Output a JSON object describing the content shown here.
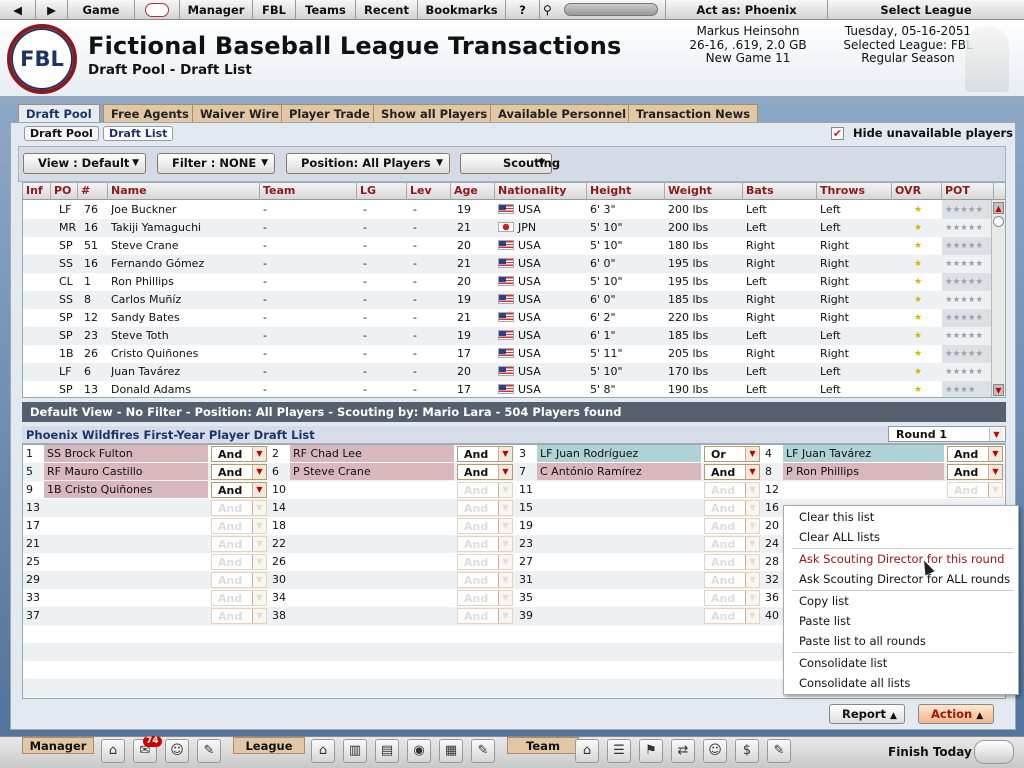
{
  "topbar": {
    "back": "◀",
    "fwd": "▶",
    "game": "Game",
    "manager": "Manager",
    "fbl": "FBL",
    "teams": "Teams",
    "recent": "Recent",
    "bookmarks": "Bookmarks",
    "help": "?",
    "act_as": "Act as: Phoenix",
    "select_league": "Select League"
  },
  "header": {
    "logo": "FBL",
    "title": "Fictional Baseball League Transactions",
    "subtitle": "Draft Pool - Draft List",
    "user_name": "Markus Heinsohn",
    "user_record": "26-16, .619, 2.0 GB",
    "user_game": "New Game 11",
    "date": "Tuesday, 05-16-2051",
    "selected_league": "Selected League: FBL",
    "season": "Regular Season"
  },
  "tabs": [
    "Draft Pool",
    "Free Agents",
    "Waiver Wire",
    "Player Trade",
    "Show all Players",
    "Available Personnel",
    "Transaction News"
  ],
  "subtabs": [
    "Draft Pool",
    "Draft List"
  ],
  "hide_unavailable": {
    "label": "Hide unavailable players",
    "checked": "✔"
  },
  "filters": {
    "view": "View : Default",
    "filter": "Filter : NONE",
    "position": "Position: All Players",
    "scouting": "Scouting"
  },
  "columns": [
    "Inf",
    "PO",
    "#",
    "Name",
    "Team",
    "LG",
    "Lev",
    "Age",
    "Nationality",
    "Height",
    "Weight",
    "Bats",
    "Throws",
    "OVR",
    "POT"
  ],
  "players": [
    {
      "pos": "LF",
      "num": "76",
      "name": "Joe Buckner",
      "team": "-",
      "lg": "-",
      "lev": "-",
      "age": "19",
      "nat": "USA",
      "flag": "usa",
      "height": "6' 3\"",
      "weight": "200 lbs",
      "bats": "Left",
      "throws": "Left",
      "ovr": "★",
      "pot": "★★★★★"
    },
    {
      "pos": "MR",
      "num": "16",
      "name": "Takiji Yamaguchi",
      "team": "-",
      "lg": "-",
      "lev": "-",
      "age": "21",
      "nat": "JPN",
      "flag": "jpn",
      "height": "5' 10\"",
      "weight": "200 lbs",
      "bats": "Left",
      "throws": "Left",
      "ovr": "★",
      "pot": "★★★★★"
    },
    {
      "pos": "SP",
      "num": "51",
      "name": "Steve Crane",
      "team": "-",
      "lg": "-",
      "lev": "-",
      "age": "20",
      "nat": "USA",
      "flag": "usa",
      "height": "5' 10\"",
      "weight": "180 lbs",
      "bats": "Right",
      "throws": "Right",
      "ovr": "★",
      "pot": "★★★★★"
    },
    {
      "pos": "SS",
      "num": "16",
      "name": "Fernando Gómez",
      "team": "-",
      "lg": "-",
      "lev": "-",
      "age": "21",
      "nat": "USA",
      "flag": "usa",
      "height": "6' 0\"",
      "weight": "195 lbs",
      "bats": "Right",
      "throws": "Right",
      "ovr": "★",
      "pot": "★★★★★"
    },
    {
      "pos": "CL",
      "num": "1",
      "name": "Ron Phillips",
      "team": "-",
      "lg": "-",
      "lev": "-",
      "age": "20",
      "nat": "USA",
      "flag": "usa",
      "height": "5' 10\"",
      "weight": "195 lbs",
      "bats": "Left",
      "throws": "Right",
      "ovr": "★",
      "pot": "★★★★★"
    },
    {
      "pos": "SS",
      "num": "8",
      "name": "Carlos Muñíz",
      "team": "-",
      "lg": "-",
      "lev": "-",
      "age": "19",
      "nat": "USA",
      "flag": "usa",
      "height": "6' 0\"",
      "weight": "185 lbs",
      "bats": "Right",
      "throws": "Right",
      "ovr": "★",
      "pot": "★★★★★"
    },
    {
      "pos": "SP",
      "num": "12",
      "name": "Sandy Bates",
      "team": "-",
      "lg": "-",
      "lev": "-",
      "age": "21",
      "nat": "USA",
      "flag": "usa",
      "height": "6' 2\"",
      "weight": "220 lbs",
      "bats": "Right",
      "throws": "Right",
      "ovr": "★",
      "pot": "★★★★★"
    },
    {
      "pos": "SP",
      "num": "23",
      "name": "Steve Toth",
      "team": "-",
      "lg": "-",
      "lev": "-",
      "age": "19",
      "nat": "USA",
      "flag": "usa",
      "height": "6' 1\"",
      "weight": "185 lbs",
      "bats": "Left",
      "throws": "Left",
      "ovr": "★",
      "pot": "★★★★★"
    },
    {
      "pos": "1B",
      "num": "26",
      "name": "Cristo Quiñones",
      "team": "-",
      "lg": "-",
      "lev": "-",
      "age": "17",
      "nat": "USA",
      "flag": "usa",
      "height": "5' 11\"",
      "weight": "205 lbs",
      "bats": "Right",
      "throws": "Right",
      "ovr": "★",
      "pot": "★★★★★"
    },
    {
      "pos": "LF",
      "num": "6",
      "name": "Juan Tavárez",
      "team": "-",
      "lg": "-",
      "lev": "-",
      "age": "20",
      "nat": "USA",
      "flag": "usa",
      "height": "5' 10\"",
      "weight": "170 lbs",
      "bats": "Left",
      "throws": "Left",
      "ovr": "★",
      "pot": "★★★★★"
    },
    {
      "pos": "SP",
      "num": "13",
      "name": "Donald Adams",
      "team": "-",
      "lg": "-",
      "lev": "-",
      "age": "17",
      "nat": "USA",
      "flag": "usa",
      "height": "5' 8\"",
      "weight": "190 lbs",
      "bats": "Left",
      "throws": "Left",
      "ovr": "★",
      "pot": "★★★★"
    }
  ],
  "status_line": "Default View - No Filter - Position: All Players - Scouting by: Mario Lara - 504 Players found",
  "draft_list": {
    "title": "Phoenix Wildfires First-Year Player Draft List",
    "round": "Round 1",
    "slots": [
      {
        "n": "1",
        "name": "SS Brock Fulton",
        "op": "And",
        "style": "p"
      },
      {
        "n": "2",
        "name": "RF Chad Lee",
        "op": "And",
        "style": "p"
      },
      {
        "n": "3",
        "name": "LF Juan Rodríguez",
        "op": "Or",
        "style": "t"
      },
      {
        "n": "4",
        "name": "LF Juan Taváre​z",
        "op": "And",
        "style": "t"
      },
      {
        "n": "5",
        "name": "RF Mauro Castillo",
        "op": "And",
        "style": "p"
      },
      {
        "n": "6",
        "name": "P Steve Crane",
        "op": "And",
        "style": "p"
      },
      {
        "n": "7",
        "name": "C António Ramírez",
        "op": "And",
        "style": "p"
      },
      {
        "n": "8",
        "name": "P Ron Phillips",
        "op": "And",
        "style": "p"
      },
      {
        "n": "9",
        "name": "1B Cristo Quiñones",
        "op": "And",
        "style": "p"
      },
      {
        "n": "10",
        "name": "",
        "op": "And",
        "style": ""
      },
      {
        "n": "11",
        "name": "",
        "op": "And",
        "style": ""
      },
      {
        "n": "12",
        "name": "",
        "op": "And",
        "style": ""
      },
      {
        "n": "13",
        "name": "",
        "op": "And",
        "style": ""
      },
      {
        "n": "14",
        "name": "",
        "op": "And",
        "style": ""
      },
      {
        "n": "15",
        "name": "",
        "op": "And",
        "style": ""
      },
      {
        "n": "16",
        "name": "",
        "op": "",
        "style": ""
      },
      {
        "n": "17",
        "name": "",
        "op": "And",
        "style": ""
      },
      {
        "n": "18",
        "name": "",
        "op": "And",
        "style": ""
      },
      {
        "n": "19",
        "name": "",
        "op": "And",
        "style": ""
      },
      {
        "n": "20",
        "name": "",
        "op": "",
        "style": ""
      },
      {
        "n": "21",
        "name": "",
        "op": "And",
        "style": ""
      },
      {
        "n": "22",
        "name": "",
        "op": "And",
        "style": ""
      },
      {
        "n": "23",
        "name": "",
        "op": "And",
        "style": ""
      },
      {
        "n": "24",
        "name": "",
        "op": "",
        "style": ""
      },
      {
        "n": "25",
        "name": "",
        "op": "And",
        "style": ""
      },
      {
        "n": "26",
        "name": "",
        "op": "And",
        "style": ""
      },
      {
        "n": "27",
        "name": "",
        "op": "And",
        "style": ""
      },
      {
        "n": "28",
        "name": "",
        "op": "",
        "style": ""
      },
      {
        "n": "29",
        "name": "",
        "op": "And",
        "style": ""
      },
      {
        "n": "30",
        "name": "",
        "op": "And",
        "style": ""
      },
      {
        "n": "31",
        "name": "",
        "op": "And",
        "style": ""
      },
      {
        "n": "32",
        "name": "",
        "op": "",
        "style": ""
      },
      {
        "n": "33",
        "name": "",
        "op": "And",
        "style": ""
      },
      {
        "n": "34",
        "name": "",
        "op": "And",
        "style": ""
      },
      {
        "n": "35",
        "name": "",
        "op": "And",
        "style": ""
      },
      {
        "n": "36",
        "name": "",
        "op": "",
        "style": ""
      },
      {
        "n": "37",
        "name": "",
        "op": "And",
        "style": ""
      },
      {
        "n": "38",
        "name": "",
        "op": "And",
        "style": ""
      },
      {
        "n": "39",
        "name": "",
        "op": "And",
        "style": ""
      },
      {
        "n": "40",
        "name": "",
        "op": "",
        "style": ""
      }
    ]
  },
  "context_menu": [
    "Clear this list",
    "Clear ALL lists",
    "Ask Scouting Director for this round",
    "Ask Scouting Director for ALL rounds",
    "Copy list",
    "Paste list",
    "Paste list to all rounds",
    "Consolidate list",
    "Consolidate all lists"
  ],
  "buttons": {
    "report": "Report",
    "action": "Action"
  },
  "bottombar": {
    "manager": "Manager",
    "league": "League",
    "team": "Team",
    "finish": "Finish Today",
    "mail_count": "74"
  },
  "colors": {
    "accent": "#8c1a1a",
    "navy": "#1d3566",
    "tab": "#e2c7a6",
    "highlight_pink": "#d8b7bd",
    "highlight_teal": "#afd2d6"
  }
}
